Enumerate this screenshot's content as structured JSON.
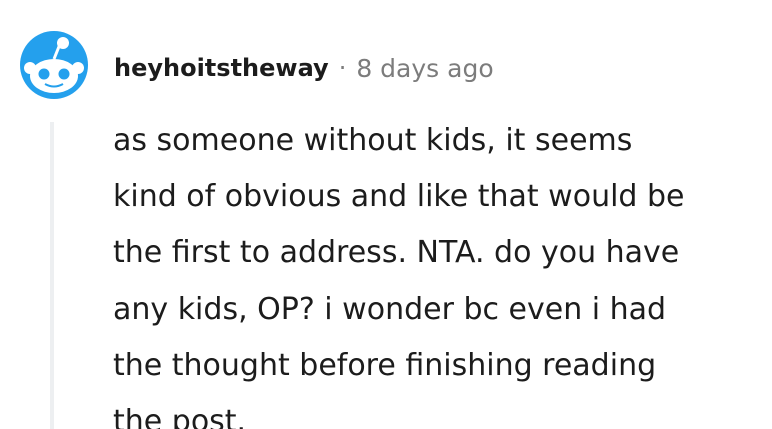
{
  "comment": {
    "author": "heyhoitstheway",
    "separator": "·",
    "timestamp": "8 days ago",
    "avatar_icon": "snoo-avatar-icon",
    "avatar_color": "#24a0ed",
    "body_lines": [
      "as someone without kids, it seems",
      "kind of obvious and like that would be",
      "the first to address. NTA. do you have",
      "any kids, OP? i wonder bc even i had",
      "the thought before finishing reading",
      "the post."
    ]
  }
}
